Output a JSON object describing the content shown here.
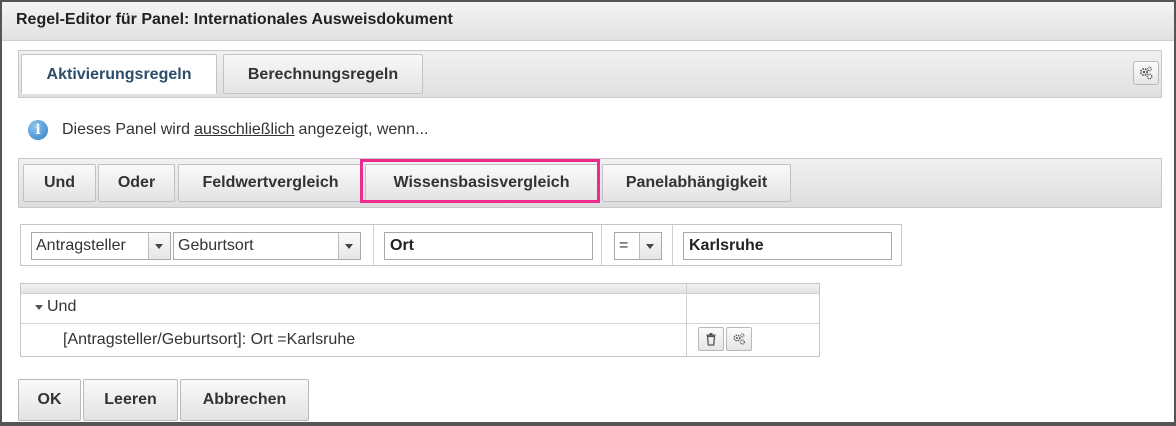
{
  "window": {
    "title": "Regel-Editor für Panel: Internationales Ausweisdokument"
  },
  "tabs": [
    {
      "label": "Aktivierungsregeln",
      "active": true
    },
    {
      "label": "Berechnungsregeln",
      "active": false
    }
  ],
  "info": {
    "icon": "info-icon",
    "prefix": "Dieses Panel wird",
    "emphasis": "ausschließlich",
    "suffix": "angezeigt, wenn..."
  },
  "operators": [
    {
      "label": "Und"
    },
    {
      "label": "Oder"
    },
    {
      "label": "Feldwertvergleich"
    },
    {
      "label": "Wissensbasisvergleich",
      "highlighted": true
    },
    {
      "label": "Panelabhängigkeit"
    }
  ],
  "condition": {
    "entity": "Antragsteller",
    "field": "Geburtsort",
    "attribute": "Ort",
    "operator": "=",
    "value": "Karlsruhe"
  },
  "rules": {
    "root": "Und",
    "items": [
      {
        "text": "[Antragsteller/Geburtsort]: Ort =Karlsruhe"
      }
    ]
  },
  "footer": {
    "ok": "OK",
    "clear": "Leeren",
    "cancel": "Abbrechen"
  },
  "colors": {
    "highlight": "#ee2b8c",
    "active_tab_text": "#2b4d6a",
    "info": "#2f7fc6"
  }
}
